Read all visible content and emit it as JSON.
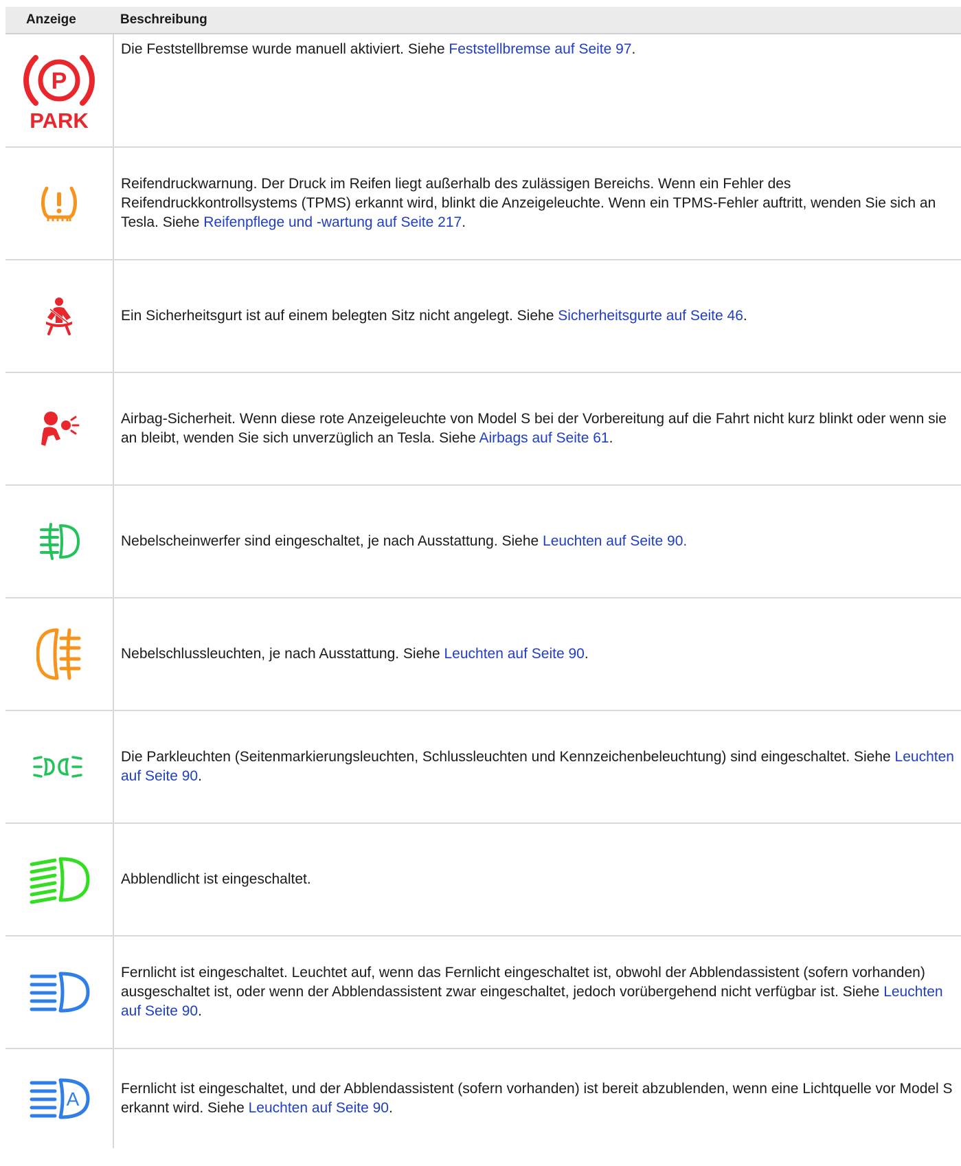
{
  "table": {
    "headers": {
      "indicator": "Anzeige",
      "description": "Beschreibung"
    },
    "rows": [
      {
        "icon": "parking-brake-park-icon",
        "park_label": "PARK",
        "text": "Die Feststellbremse wurde manuell aktiviert. Siehe ",
        "link": "Feststellbremse auf Seite 97",
        "tail": "."
      },
      {
        "icon": "tire-pressure-warning-icon",
        "text": "Reifendruckwarnung. Der Druck im Reifen liegt außerhalb des zulässigen Bereichs. Wenn ein Fehler des Reifendruckkontrollsystems (TPMS) erkannt wird, blinkt die Anzeigeleuchte. Wenn ein TPMS-Fehler auftritt, wenden Sie sich an Tesla. Siehe ",
        "link": "Reifenpflege und -wartung auf Seite 217",
        "tail": "."
      },
      {
        "icon": "seat-belt-warning-icon",
        "text": "Ein Sicherheitsgurt ist auf einem belegten Sitz nicht angelegt. Siehe ",
        "link": "Sicherheitsgurte auf Seite 46",
        "tail": "."
      },
      {
        "icon": "airbag-warning-icon",
        "text": "Airbag-Sicherheit. Wenn diese rote Anzeigeleuchte von Model S bei der Vorbereitung auf die Fahrt nicht kurz blinkt oder wenn sie an bleibt, wenden Sie sich unverzüglich an Tesla. Siehe ",
        "link": "Airbags auf Seite 61",
        "tail": "."
      },
      {
        "icon": "front-fog-light-icon",
        "text": "Nebelscheinwerfer sind eingeschaltet, je nach Ausstattung. Siehe ",
        "link": "Leuchten auf Seite 90.",
        "tail": ""
      },
      {
        "icon": "rear-fog-light-icon",
        "text": "Nebelschlussleuchten, je nach Ausstattung. Siehe ",
        "link": "Leuchten auf Seite 90",
        "tail": "."
      },
      {
        "icon": "parking-lights-icon",
        "text": "Die Parkleuchten (Seitenmarkierungsleuchten, Schlussleuchten und Kennzeichenbeleuchtung) sind eingeschaltet. Siehe ",
        "link": "Leuchten auf Seite 90",
        "tail": "."
      },
      {
        "icon": "low-beam-icon",
        "text": "Abblendlicht ist eingeschaltet.",
        "link": "",
        "tail": ""
      },
      {
        "icon": "high-beam-icon",
        "text": "Fernlicht ist eingeschaltet. Leuchtet auf, wenn das Fernlicht eingeschaltet ist, obwohl der Abblendassistent (sofern vorhanden) ausgeschaltet ist, oder wenn der Abblendassistent zwar eingeschaltet, jedoch vorübergehend nicht verfügbar ist. Siehe ",
        "link": "Leuchten auf Seite 90",
        "tail": "."
      },
      {
        "icon": "auto-high-beam-icon",
        "auto_label": "A",
        "text": "Fernlicht ist eingeschaltet, und der Abblendassistent (sofern vorhanden) ist bereit abzublenden, wenn eine Lichtquelle vor Model S erkannt wird. Siehe ",
        "link": "Leuchten auf Seite 90",
        "tail": "."
      }
    ]
  },
  "colors": {
    "red": "#e8262b",
    "orange": "#f7941d",
    "green": "#22c35a",
    "bright_green": "#33dd22",
    "blue": "#2f7fe6",
    "link": "#1f3ec5"
  }
}
